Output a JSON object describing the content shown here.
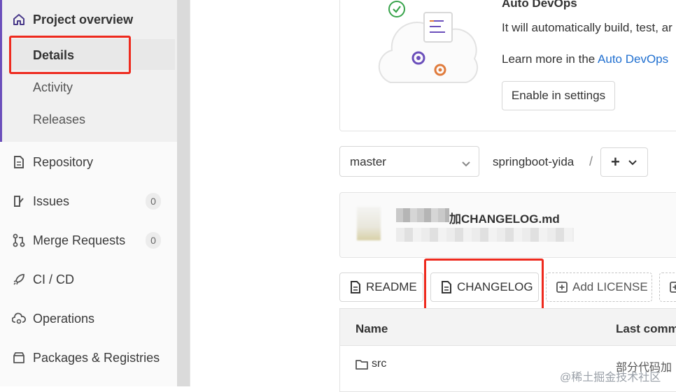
{
  "sidebar": {
    "project_overview": "Project overview",
    "details": "Details",
    "activity": "Activity",
    "releases": "Releases",
    "repository": "Repository",
    "issues": "Issues",
    "issues_count": "0",
    "merge_requests": "Merge Requests",
    "merge_requests_count": "0",
    "cicd": "CI / CD",
    "operations": "Operations",
    "packages": "Packages & Registries",
    "accent_color": "#6b4fbb"
  },
  "autodevops": {
    "title": "Auto DevOps",
    "description": "It will automatically build, test, ar",
    "learn_prefix": "Learn more in the ",
    "learn_link": "Auto DevOps",
    "enable_button": "Enable in settings"
  },
  "repo": {
    "branch": "master",
    "project": "springboot-yida",
    "separator": "/",
    "add_label": "+"
  },
  "commit": {
    "title": "加CHANGELOG.md"
  },
  "file_buttons": {
    "readme": "README",
    "changelog": "CHANGELOG",
    "add_license": "Add LICENSE"
  },
  "table": {
    "col_name": "Name",
    "col_last_commit": "Last comm",
    "rows": [
      {
        "name": "src",
        "last_commit": "部分代码加"
      }
    ]
  },
  "watermark": "@稀土掘金技术社区",
  "highlight_color": "#ee2a1e"
}
